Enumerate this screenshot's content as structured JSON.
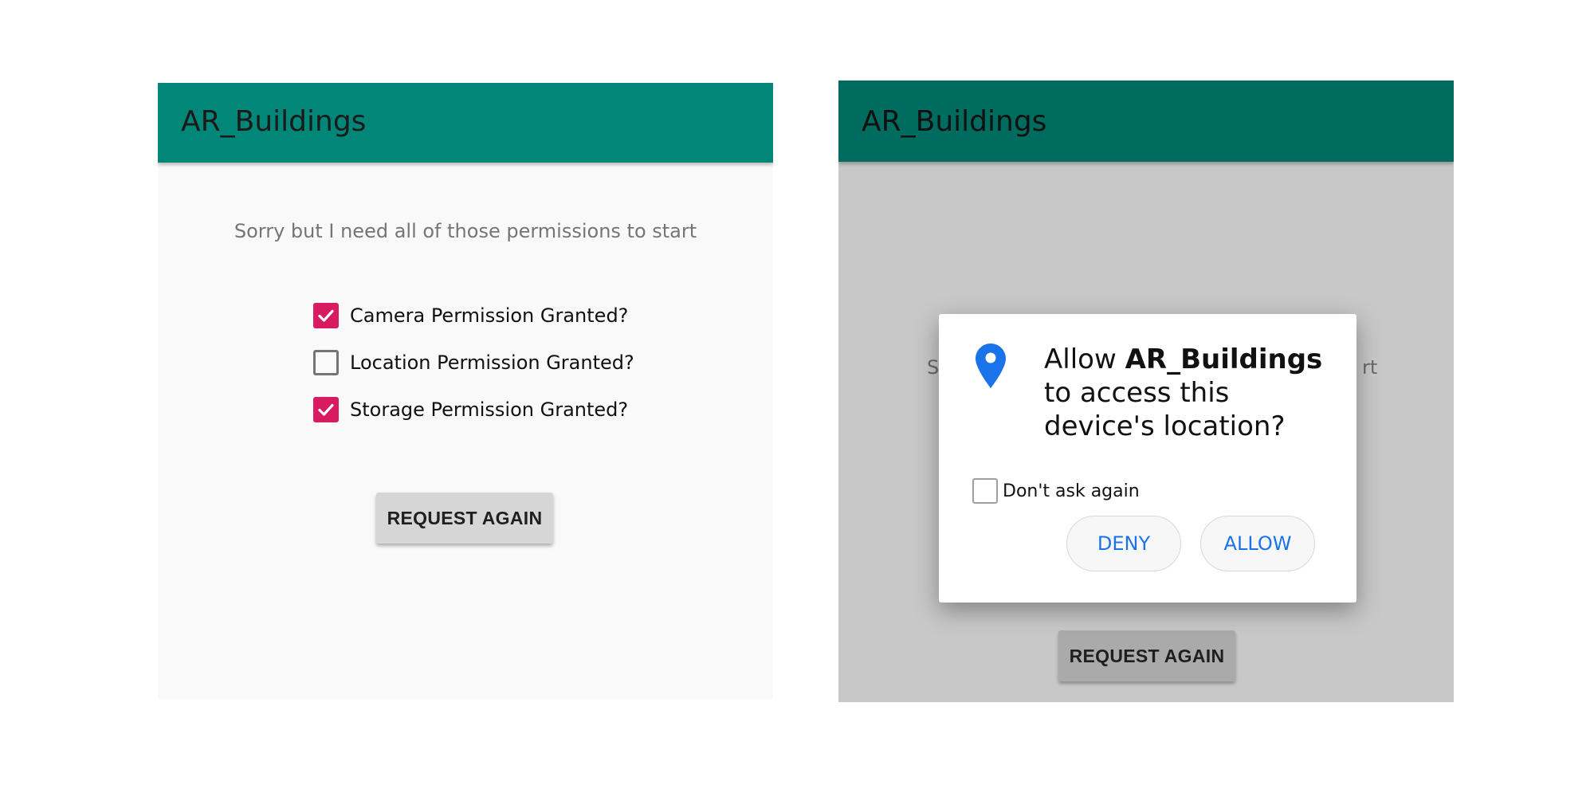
{
  "colors": {
    "appbar_left": "#028677",
    "appbar_right": "#006b5f",
    "checkbox_checked": "#d81b60",
    "accent_blue": "#1a73e8",
    "button_left": "#d6d6d6",
    "button_right": "#aaaaaa"
  },
  "left_screen": {
    "app_title": "AR_Buildings",
    "message": "Sorry but I need all of those permissions to start",
    "permissions": [
      {
        "label": "Camera Permission Granted?",
        "checked": true
      },
      {
        "label": "Location Permission Granted?",
        "checked": false
      },
      {
        "label": "Storage Permission Granted?",
        "checked": true
      }
    ],
    "request_button": "REQUEST AGAIN"
  },
  "right_screen": {
    "app_title": "AR_Buildings",
    "message_left_visible": "S",
    "message_right_visible": "rt",
    "request_button": "REQUEST AGAIN",
    "dialog": {
      "icon": "location-pin-icon",
      "title_prefix": "Allow ",
      "app_name": "AR_Buildings",
      "title_suffix": " to access this device's location?",
      "dont_ask_label": "Don't ask again",
      "dont_ask_checked": false,
      "deny_label": "DENY",
      "allow_label": "ALLOW"
    }
  }
}
